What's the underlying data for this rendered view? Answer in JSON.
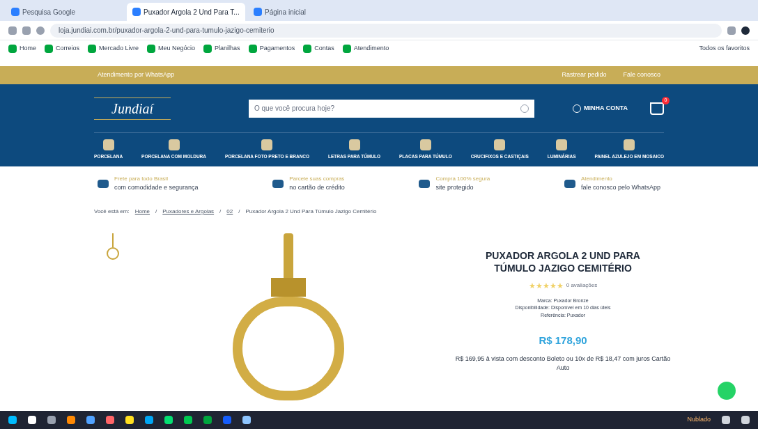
{
  "browser": {
    "tabs": [
      {
        "label": "Pesquisa Google",
        "selected": false
      },
      {
        "label": "Puxador Argola 2 Und Para T...",
        "selected": true
      },
      {
        "label": "Página inicial",
        "selected": false
      }
    ],
    "url": "loja.jundiai.com.br/puxador-argola-2-und-para-tumulo-jazigo-cemiterio",
    "bookmarks": [
      "Home",
      "Correios",
      "Mercado Livre",
      "Meu Negócio",
      "Planilhas",
      "Pagamentos",
      "Contas",
      "Atendimento"
    ],
    "other_bookmarks": "Todos os favoritos"
  },
  "topbar": {
    "left": "Atendimento por WhatsApp",
    "right": [
      "Rastrear pedido",
      "Fale conosco"
    ]
  },
  "header": {
    "logo": "Jundiaí",
    "search_placeholder": "O que você procura hoje?",
    "account": "MINHA CONTA",
    "cart_count": "0"
  },
  "nav": [
    "PORCELANA",
    "PORCELANA COM MOLDURA",
    "PORCELANA FOTO PRETO E BRANCO",
    "LETRAS PARA TÚMULO",
    "PLACAS PARA TÚMULO",
    "CRUCIFIXOS E CASTIÇAIS",
    "LUMINÁRIAS",
    "PAINEL AZULEJO EM MOSAICO"
  ],
  "benefits": [
    {
      "title": "Frete para todo Brasil",
      "text": "com comodidade e segurança"
    },
    {
      "title": "Parcele suas compras",
      "text": "no cartão de crédito"
    },
    {
      "title": "Compra 100% segura",
      "text": "site protegido"
    },
    {
      "title": "Atendimento",
      "text": "fale conosco pelo WhatsApp"
    }
  ],
  "breadcrumb": {
    "prefix": "Você está em:",
    "separator": "/",
    "items": [
      "Home",
      "Puxadores e Argolas",
      "02"
    ],
    "current": "Puxador Argola 2 Und Para Túmulo Jazigo Cemitério"
  },
  "product": {
    "title": "PUXADOR ARGOLA 2 UND PARA TÚMULO JAZIGO CEMITÉRIO",
    "stars": 5,
    "reviews": "0 avaliações",
    "details": [
      "Marca: Puxador Bronze",
      "Disponibilidade: Disponível em 10 dias úteis",
      "Referência: Puxador"
    ],
    "price": "R$ 178,90",
    "installments": "R$ 169,95 à vista com desconto Boleto ou 10x de R$ 18,47 com juros Cartão Auto"
  },
  "taskbar": {
    "weather": "Nublado"
  }
}
